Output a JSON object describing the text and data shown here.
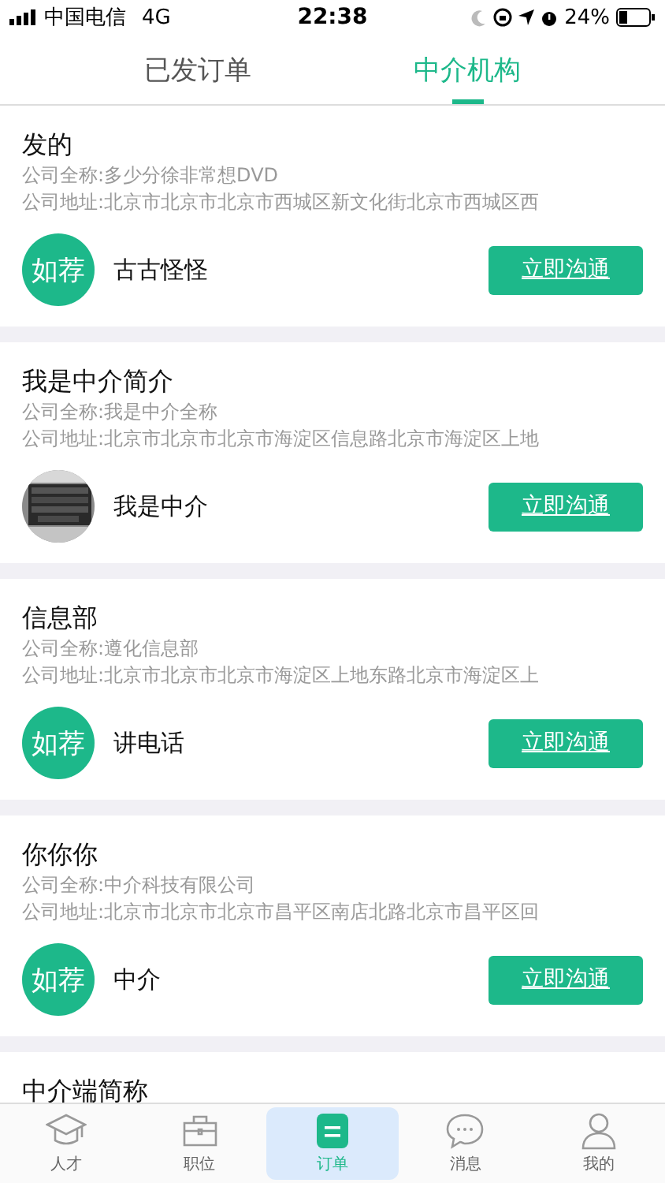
{
  "status_bar": {
    "carrier": "中国电信",
    "network": "4G",
    "time": "22:38",
    "battery": "24%"
  },
  "tabs": [
    {
      "label": "已发订单",
      "selected": false
    },
    {
      "label": "中介机构",
      "selected": true
    }
  ],
  "agencies": [
    {
      "title": "发的",
      "full_name": "公司全称:多少分徐非常想DVD",
      "address": "公司地址:北京市北京市北京市西城区新文化街北京市西城区西",
      "avatar": {
        "kind": "logo",
        "text": "如荐"
      },
      "contact": "古古怪怪",
      "button": "立即沟通"
    },
    {
      "title": "我是中介简介",
      "full_name": "公司全称:我是中介全称",
      "address": "公司地址:北京市北京市北京市海淀区信息路北京市海淀区上地",
      "contact": "我是中介",
      "button": "立即沟通"
    },
    {
      "title": "信息部",
      "full_name": "公司全称:遵化信息部",
      "address": "公司地址:北京市北京市北京市海淀区上地东路北京市海淀区上",
      "avatar": {
        "kind": "logo",
        "text": "如荐"
      },
      "contact": "讲电话",
      "button": "立即沟通"
    },
    {
      "title": "你你你",
      "full_name": "公司全称:中介科技有限公司",
      "address": "公司地址:北京市北京市北京市昌平区南店北路北京市昌平区回",
      "avatar": {
        "kind": "logo",
        "text": "如荐"
      },
      "contact": "中介",
      "button": "立即沟通"
    },
    {
      "title": "中介端简称"
    }
  ],
  "bottom_nav": [
    {
      "label": "人才",
      "selected": false
    },
    {
      "label": "职位",
      "selected": false
    },
    {
      "label": "订单",
      "selected": true
    },
    {
      "label": "消息",
      "selected": false
    },
    {
      "label": "我的",
      "selected": false
    }
  ]
}
